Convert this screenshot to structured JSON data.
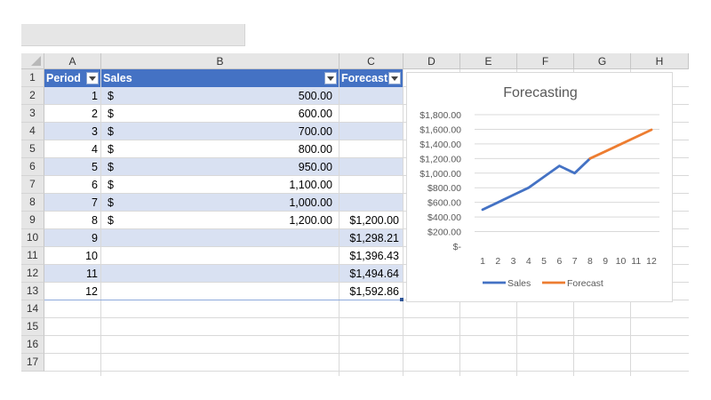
{
  "sheet": {
    "columns": [
      "A",
      "B",
      "C",
      "D",
      "E",
      "F",
      "G",
      "H"
    ],
    "rows": [
      "1",
      "2",
      "3",
      "4",
      "5",
      "6",
      "7",
      "8",
      "9",
      "10",
      "11",
      "12",
      "13",
      "14",
      "15",
      "16",
      "17"
    ]
  },
  "table": {
    "headers": {
      "period": "Period",
      "sales": "Sales",
      "forecast": "Forecast"
    },
    "rows": [
      {
        "period": "1",
        "currency": "$",
        "sales": "500.00",
        "forecast": ""
      },
      {
        "period": "2",
        "currency": "$",
        "sales": "600.00",
        "forecast": ""
      },
      {
        "period": "3",
        "currency": "$",
        "sales": "700.00",
        "forecast": ""
      },
      {
        "period": "4",
        "currency": "$",
        "sales": "800.00",
        "forecast": ""
      },
      {
        "period": "5",
        "currency": "$",
        "sales": "950.00",
        "forecast": ""
      },
      {
        "period": "6",
        "currency": "$",
        "sales": "1,100.00",
        "forecast": ""
      },
      {
        "period": "7",
        "currency": "$",
        "sales": "1,000.00",
        "forecast": ""
      },
      {
        "period": "8",
        "currency": "$",
        "sales": "1,200.00",
        "forecast": "$1,200.00"
      },
      {
        "period": "9",
        "currency": "",
        "sales": "",
        "forecast": "$1,298.21"
      },
      {
        "period": "10",
        "currency": "",
        "sales": "",
        "forecast": "$1,396.43"
      },
      {
        "period": "11",
        "currency": "",
        "sales": "",
        "forecast": "$1,494.64"
      },
      {
        "period": "12",
        "currency": "",
        "sales": "",
        "forecast": "$1,592.86"
      }
    ]
  },
  "colors": {
    "header_fill": "#4472c4",
    "band_fill": "#d9e1f2",
    "sales_line": "#4472c4",
    "forecast_line": "#ed7d31"
  },
  "icons": {
    "filter": "filter-dropdown-icon",
    "select_all": "select-all-corner-icon"
  },
  "chart_data": {
    "type": "line",
    "title": "Forecasting",
    "categories": [
      1,
      2,
      3,
      4,
      5,
      6,
      7,
      8,
      9,
      10,
      11,
      12
    ],
    "ytick_labels": [
      "$-",
      "$200.00",
      "$400.00",
      "$600.00",
      "$800.00",
      "$1,000.00",
      "$1,200.00",
      "$1,400.00",
      "$1,600.00",
      "$1,800.00"
    ],
    "ylim": [
      0,
      1800
    ],
    "grid": true,
    "legend": "bottom",
    "series": [
      {
        "name": "Sales",
        "color": "#4472c4",
        "values": [
          500,
          600,
          700,
          800,
          950,
          1100,
          1000,
          1200,
          null,
          null,
          null,
          null
        ]
      },
      {
        "name": "Forecast",
        "color": "#ed7d31",
        "values": [
          null,
          null,
          null,
          null,
          null,
          null,
          null,
          1200,
          1298.21,
          1396.43,
          1494.64,
          1592.86
        ]
      }
    ]
  }
}
